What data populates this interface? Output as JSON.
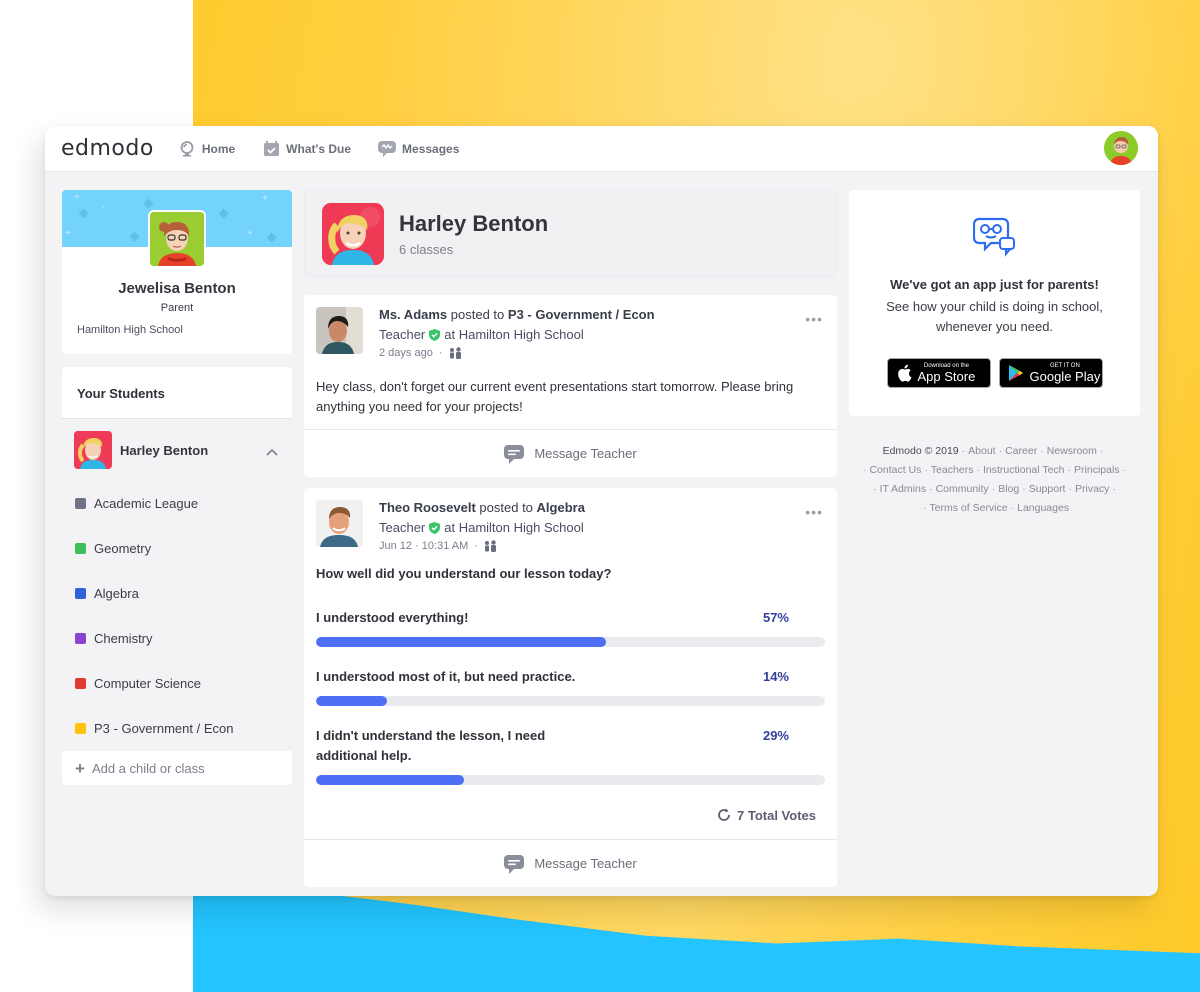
{
  "app": {
    "logo": "edmodo",
    "nav": [
      {
        "label": "Home",
        "icon": "home-icon"
      },
      {
        "label": "What's Due",
        "icon": "calendar-check-icon"
      },
      {
        "label": "Messages",
        "icon": "message-icon"
      }
    ]
  },
  "profile": {
    "name": "Jewelisa Benton",
    "role": "Parent",
    "school": "Hamilton High School"
  },
  "students_panel": {
    "title": "Your Students",
    "student": {
      "name": "Harley Benton",
      "expanded": true
    },
    "classes": [
      {
        "name": "Academic League",
        "color": "#6f7388"
      },
      {
        "name": "Geometry",
        "color": "#3fbf5a"
      },
      {
        "name": "Algebra",
        "color": "#2f64d6"
      },
      {
        "name": "Chemistry",
        "color": "#8a44d2"
      },
      {
        "name": "Computer Science",
        "color": "#e0392e"
      },
      {
        "name": "P3 - Government / Econ",
        "color": "#ffc20e"
      }
    ],
    "add_label": "Add a child or class"
  },
  "student_header": {
    "name": "Harley Benton",
    "subtitle": "6 classes"
  },
  "posts": [
    {
      "author": "Ms. Adams",
      "posted_to_text": "posted to",
      "target": "P3 - Government / Econ",
      "role": "Teacher",
      "school_text": "at Hamilton High School",
      "time": "2 days ago",
      "separator": "·",
      "body": "Hey class, don't forget our current event presentations start tomorrow. Please bring anything you need for your projects!",
      "footer_label": "Message Teacher"
    },
    {
      "author": "Theo Roosevelt",
      "posted_to_text": "posted to",
      "target": "Algebra",
      "role": "Teacher",
      "school_text": "at Hamilton High School",
      "time": "Jun 12 · 10:31 AM",
      "separator": "·",
      "poll": {
        "question": "How well did you understand our lesson today?",
        "options": [
          {
            "label": "I understood everything!",
            "percent_text": "57%",
            "percent": 57
          },
          {
            "label": "I understood most of it, but need practice.",
            "percent_text": "14%",
            "percent": 14
          },
          {
            "label": "I didn't understand the lesson, I need additional help.",
            "percent_text": "29%",
            "percent": 29
          }
        ],
        "total_votes": "7 Total Votes"
      },
      "footer_label": "Message Teacher"
    }
  ],
  "app_promo": {
    "title": "We've got an app just for parents!",
    "subtitle": "See how your child is doing in school, whenever you need.",
    "app_store": {
      "small": "Download on the",
      "big": "App Store"
    },
    "google_play": {
      "small": "GET IT ON",
      "big": "Google Play"
    }
  },
  "footer": {
    "copyright": "Edmodo © 2019",
    "links": [
      "About",
      "Career",
      "Newsroom",
      "Contact Us",
      "Teachers",
      "Instructional Tech",
      "Principals",
      "IT Admins",
      "Community",
      "Blog",
      "Support",
      "Privacy",
      "Terms of Service",
      "Languages"
    ]
  },
  "colors": {
    "accent": "#4d6ef5",
    "percent_text": "#33419c",
    "verified": "#3cc46a",
    "brand_icon": "#2b6cf0"
  }
}
